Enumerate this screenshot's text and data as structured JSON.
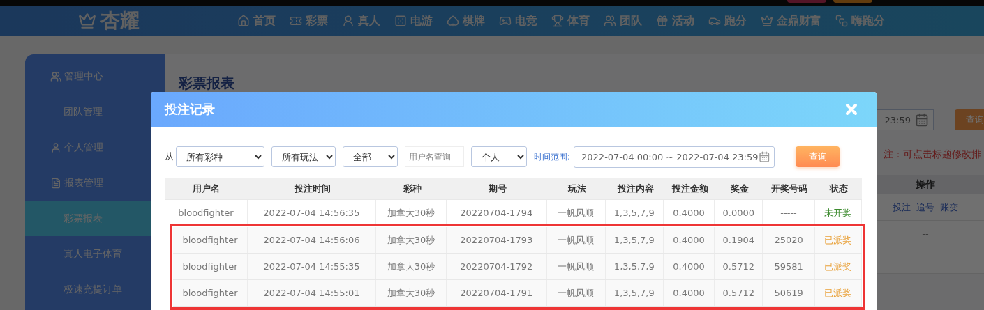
{
  "header": {
    "logo": "杏耀",
    "nav": [
      {
        "label": "首页"
      },
      {
        "label": "彩票"
      },
      {
        "label": "真人"
      },
      {
        "label": "电游"
      },
      {
        "label": "棋牌"
      },
      {
        "label": "电竞"
      },
      {
        "label": "体育"
      },
      {
        "label": "团队"
      },
      {
        "label": "活动"
      },
      {
        "label": "跑分"
      },
      {
        "label": "金鼎财富"
      },
      {
        "label": "嗨跑分"
      }
    ]
  },
  "sidebar": {
    "groups": [
      {
        "label": "管理中心",
        "children": [
          {
            "label": "团队管理",
            "selected": false
          }
        ]
      },
      {
        "label": "个人管理"
      },
      {
        "label": "报表管理",
        "children": [
          {
            "label": "彩票报表",
            "selected": true
          },
          {
            "label": "真人电子体育",
            "selected": false
          },
          {
            "label": "极速充提订单",
            "selected": false
          }
        ]
      }
    ]
  },
  "page": {
    "title": "彩票报表",
    "date_end": "23:59",
    "search_button": "查询",
    "note": "注：可点击标题修改排",
    "table": {
      "columns": [
        "操作"
      ],
      "rows": [
        {
          "kind": "links",
          "links": [
            "投注",
            "追号",
            "账变"
          ]
        },
        {
          "kind": "text",
          "text": "--"
        },
        {
          "kind": "text",
          "text": "--"
        }
      ]
    }
  },
  "dialog": {
    "title": "投注记录",
    "filters": {
      "from_label": "从",
      "selects": [
        "所有彩种",
        "所有玩法",
        "全部"
      ],
      "username": {
        "placeholder": "用户名查询"
      },
      "scope": "个人",
      "range_label": "时间范围:",
      "range": "2022-07-04 00:00 ~ 2022-07-04 23:59",
      "search_button": "查询"
    },
    "table": {
      "columns": [
        "用户名",
        "投注时间",
        "彩种",
        "期号",
        "玩法",
        "投注内容",
        "投注金额",
        "奖金",
        "开奖号码",
        "状态"
      ],
      "rows": [
        {
          "cells": [
            "bloodfighter",
            "2022-07-04 14:56:35",
            "加拿大30秒",
            "20220704-1794",
            "一帆风顺",
            "1,3,5,7,9",
            "0.4000",
            "0.0000",
            "-----"
          ],
          "status": {
            "text": "未开奖",
            "color": "#3d8b2f"
          },
          "highlighted": false
        },
        {
          "cells": [
            "bloodfighter",
            "2022-07-04 14:56:06",
            "加拿大30秒",
            "20220704-1793",
            "一帆风顺",
            "1,3,5,7,9",
            "0.4000",
            "0.1904",
            "25020"
          ],
          "status": {
            "text": "已派奖",
            "color": "#e9a23b"
          },
          "highlighted": true
        },
        {
          "cells": [
            "bloodfighter",
            "2022-07-04 14:55:35",
            "加拿大30秒",
            "20220704-1792",
            "一帆风顺",
            "1,3,5,7,9",
            "0.4000",
            "0.5712",
            "59581"
          ],
          "status": {
            "text": "已派奖",
            "color": "#e9a23b"
          },
          "highlighted": true
        },
        {
          "cells": [
            "bloodfighter",
            "2022-07-04 14:55:01",
            "加拿大30秒",
            "20220704-1791",
            "一帆风顺",
            "1,3,5,7,9",
            "0.4000",
            "0.5712",
            "50619"
          ],
          "status": {
            "text": "已派奖",
            "color": "#e9a23b"
          },
          "highlighted": true
        }
      ]
    }
  }
}
